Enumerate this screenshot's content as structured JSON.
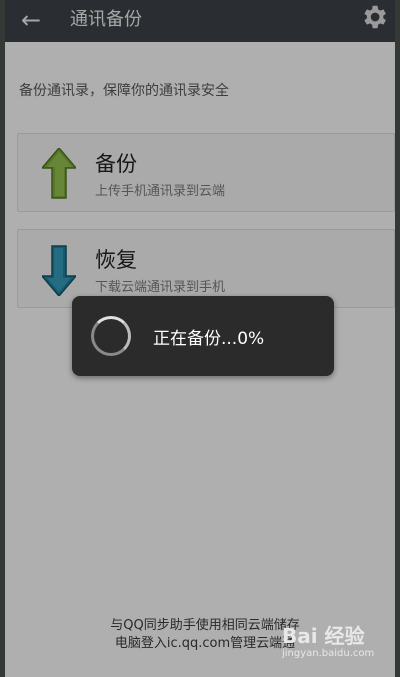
{
  "header": {
    "back_icon": "back-arrow-icon",
    "title": "通讯备份",
    "settings_icon": "gear-icon"
  },
  "subtitle": "备份通讯录，保障你的通讯录安全",
  "cards": [
    {
      "title": "备份",
      "description": "上传手机通讯录到云端",
      "icon": "up-arrow-icon",
      "color": "#7aa53a"
    },
    {
      "title": "恢复",
      "description": "下载云端通讯录到手机",
      "icon": "down-arrow-icon",
      "color": "#1f7d9a"
    }
  ],
  "progress_dialog": {
    "message": "正在备份...0%",
    "icon": "loading-spinner-icon"
  },
  "footer": {
    "line1": "与QQ同步助手使用相同云端储存",
    "line2": "电脑登入ic.qq.com管理云端通"
  },
  "watermark": {
    "logo": "Bai 经验",
    "url": "jingyan.baidu.com"
  }
}
